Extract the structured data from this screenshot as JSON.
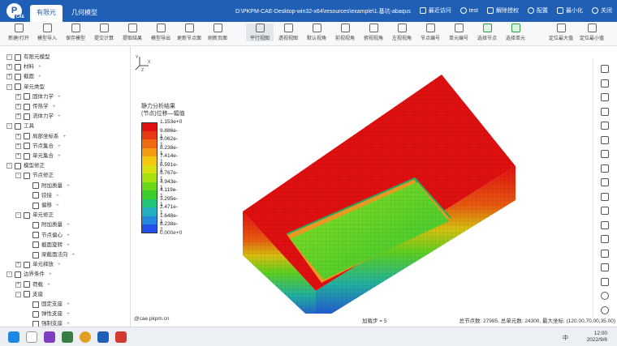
{
  "titlebar": {
    "logo": "P",
    "logo_sub": "CAE",
    "tabs": [
      "有限元",
      "几何模型"
    ],
    "path": "D:\\PKPM-CAE-Desktop-win32-x64\\resources\\example\\1.基坑-abaqus",
    "right": [
      "最近访问",
      "test",
      "解除授权",
      "配置",
      "最小化",
      "关闭"
    ]
  },
  "ribbon": {
    "items": [
      "新建/打开",
      "模型导入",
      "保存模型",
      "提交计算",
      "提取结果",
      "模型导出",
      "更新节点面",
      "刷新页面",
      "平行视图",
      "透视视图",
      "默认视角",
      "前视视角",
      "俯视视角",
      "左视视角",
      "节点编号",
      "单元编号",
      "选择节点",
      "选择单元",
      "定位最大值",
      "定位最小值"
    ],
    "selected_index": 8
  },
  "tree": [
    {
      "label": "有限元模型",
      "level": 0,
      "exp": "-",
      "plus": false
    },
    {
      "label": "材料",
      "level": 0,
      "exp": "+",
      "plus": true
    },
    {
      "label": "截面",
      "level": 0,
      "exp": "+",
      "plus": true
    },
    {
      "label": "单元类型",
      "level": 0,
      "exp": "-",
      "plus": false
    },
    {
      "label": "固体力学",
      "level": 1,
      "exp": "+",
      "plus": true
    },
    {
      "label": "传热学",
      "level": 1,
      "exp": "+",
      "plus": true
    },
    {
      "label": "流体力学",
      "level": 1,
      "exp": "+",
      "plus": true
    },
    {
      "label": "工具",
      "level": 0,
      "exp": "-",
      "plus": false
    },
    {
      "label": "局部坐标系",
      "level": 1,
      "exp": "+",
      "plus": true
    },
    {
      "label": "节点集合",
      "level": 1,
      "exp": "+",
      "plus": true
    },
    {
      "label": "单元集合",
      "level": 1,
      "exp": "+",
      "plus": true
    },
    {
      "label": "模型修正",
      "level": 0,
      "exp": "-",
      "plus": false
    },
    {
      "label": "节点修正",
      "level": 1,
      "exp": "-",
      "plus": false
    },
    {
      "label": "附加质量",
      "level": 2,
      "exp": "",
      "plus": true
    },
    {
      "label": "铰接",
      "level": 2,
      "exp": "",
      "plus": true
    },
    {
      "label": "偏移",
      "level": 2,
      "exp": "",
      "plus": true
    },
    {
      "label": "单元修正",
      "level": 1,
      "exp": "-",
      "plus": false
    },
    {
      "label": "附加质量",
      "level": 2,
      "exp": "",
      "plus": true
    },
    {
      "label": "节点偏心",
      "level": 2,
      "exp": "",
      "plus": true
    },
    {
      "label": "截面旋转",
      "level": 2,
      "exp": "",
      "plus": true
    },
    {
      "label": "梁截面法向",
      "level": 2,
      "exp": "",
      "plus": true
    },
    {
      "label": "单元释放",
      "level": 1,
      "exp": "+",
      "plus": true
    },
    {
      "label": "边界条件",
      "level": 0,
      "exp": "-",
      "plus": true
    },
    {
      "label": "荷载",
      "level": 1,
      "exp": "+",
      "plus": true
    },
    {
      "label": "支座",
      "level": 1,
      "exp": "-",
      "plus": false
    },
    {
      "label": "固定支座",
      "level": 2,
      "exp": "",
      "plus": true
    },
    {
      "label": "弹性支座",
      "level": 2,
      "exp": "",
      "plus": true
    },
    {
      "label": "强制支座",
      "level": 2,
      "exp": "",
      "plus": true
    }
  ],
  "viewport": {
    "axes": "Y X Z",
    "legend_title_1": "静力分析结果",
    "legend_title_2": "(节点)位移—幅值",
    "legend_values": [
      "1.153e+0",
      "9.886e-1",
      "9.062e-1",
      "8.238e-1",
      "7.414e-1",
      "6.591e-1",
      "5.767e-1",
      "4.943e-1",
      "4.119e-1",
      "3.295e-1",
      "2.471e-1",
      "1.648e-1",
      "8.238e-2",
      "0.000e+0"
    ],
    "legend_colors": [
      "#e01010",
      "#e83a10",
      "#f06a10",
      "#f59a10",
      "#f5c810",
      "#d8e010",
      "#a8e010",
      "#6cd81a",
      "#3ccf2a",
      "#22c47a",
      "#22b0c0",
      "#2288e0",
      "#2250e8"
    ],
    "status_left": "@cae.pkpm.cn",
    "status_mid": "加载步 = 5",
    "status_right": "总节点数: 27985, 总单元数: 24300, 最大坐标: (120.00,70.00,35.00)"
  },
  "taskbar": {
    "tray": "中",
    "time": "12:00",
    "date": "2022/9/6"
  }
}
